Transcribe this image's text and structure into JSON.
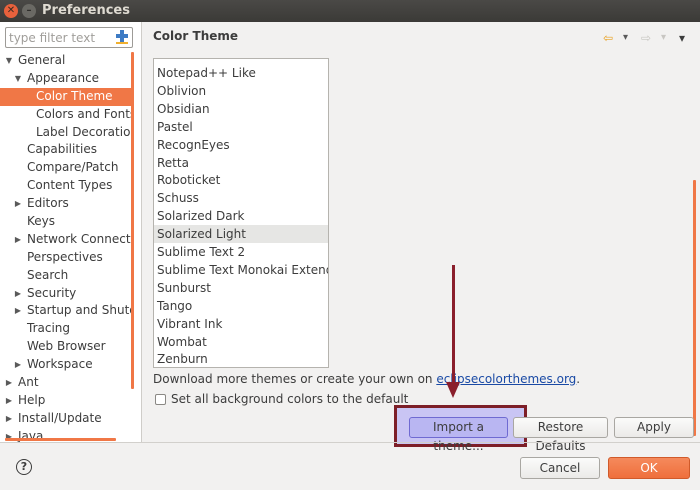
{
  "window": {
    "title": "Preferences",
    "close_glyph": "✕",
    "min_glyph": "–"
  },
  "filter": {
    "placeholder": "type filter text",
    "icon": "clear-filter-icon"
  },
  "tree": [
    {
      "label": "General",
      "indent": 0,
      "arrow": "▼"
    },
    {
      "label": "Appearance",
      "indent": 1,
      "arrow": "▼"
    },
    {
      "label": "Color Theme",
      "indent": 2,
      "arrow": "",
      "selected": true
    },
    {
      "label": "Colors and Fonts",
      "indent": 2,
      "arrow": ""
    },
    {
      "label": "Label Decorations",
      "indent": 2,
      "arrow": ""
    },
    {
      "label": "Capabilities",
      "indent": 1,
      "arrow": ""
    },
    {
      "label": "Compare/Patch",
      "indent": 1,
      "arrow": ""
    },
    {
      "label": "Content Types",
      "indent": 1,
      "arrow": ""
    },
    {
      "label": "Editors",
      "indent": 1,
      "arrow": "▶"
    },
    {
      "label": "Keys",
      "indent": 1,
      "arrow": ""
    },
    {
      "label": "Network Connection",
      "indent": 1,
      "arrow": "▶"
    },
    {
      "label": "Perspectives",
      "indent": 1,
      "arrow": ""
    },
    {
      "label": "Search",
      "indent": 1,
      "arrow": ""
    },
    {
      "label": "Security",
      "indent": 1,
      "arrow": "▶"
    },
    {
      "label": "Startup and Shutdown",
      "indent": 1,
      "arrow": "▶"
    },
    {
      "label": "Tracing",
      "indent": 1,
      "arrow": ""
    },
    {
      "label": "Web Browser",
      "indent": 1,
      "arrow": ""
    },
    {
      "label": "Workspace",
      "indent": 1,
      "arrow": "▶"
    },
    {
      "label": "Ant",
      "indent": 0,
      "arrow": "▶"
    },
    {
      "label": "Help",
      "indent": 0,
      "arrow": "▶"
    },
    {
      "label": "Install/Update",
      "indent": 0,
      "arrow": "▶"
    },
    {
      "label": "Java",
      "indent": 0,
      "arrow": "▶"
    }
  ],
  "page": {
    "title": "Color Theme",
    "nav_back": "⇦",
    "nav_back_menu": "▾",
    "nav_forward": "⇨",
    "nav_forward_menu": "▾",
    "view_menu": "▾"
  },
  "themes": [
    {
      "label": "Notepad++ Like"
    },
    {
      "label": "Oblivion"
    },
    {
      "label": "Obsidian"
    },
    {
      "label": "Pastel"
    },
    {
      "label": "RecognEyes"
    },
    {
      "label": "Retta"
    },
    {
      "label": "Roboticket"
    },
    {
      "label": "Schuss"
    },
    {
      "label": "Solarized Dark"
    },
    {
      "label": "Solarized Light",
      "selected": true
    },
    {
      "label": "Sublime Text 2"
    },
    {
      "label": "Sublime Text Monokai Extended"
    },
    {
      "label": "Sunburst"
    },
    {
      "label": "Tango"
    },
    {
      "label": "Vibrant Ink"
    },
    {
      "label": "Wombat"
    },
    {
      "label": "Zenburn"
    }
  ],
  "download": {
    "text": "Download more themes or create your own on ",
    "link": "eclipsecolorthemes.org",
    "suffix": "."
  },
  "checkbox": {
    "label": "Set all background colors to the default",
    "checked": false
  },
  "buttons": {
    "import": "Import a theme...",
    "restore": "Restore Defaults",
    "apply": "Apply",
    "cancel": "Cancel",
    "ok": "OK"
  },
  "help_glyph": "?",
  "colors": {
    "accent": "#f07746",
    "annotation": "#8a1f2c",
    "import_highlight": "#b9b6f2"
  }
}
